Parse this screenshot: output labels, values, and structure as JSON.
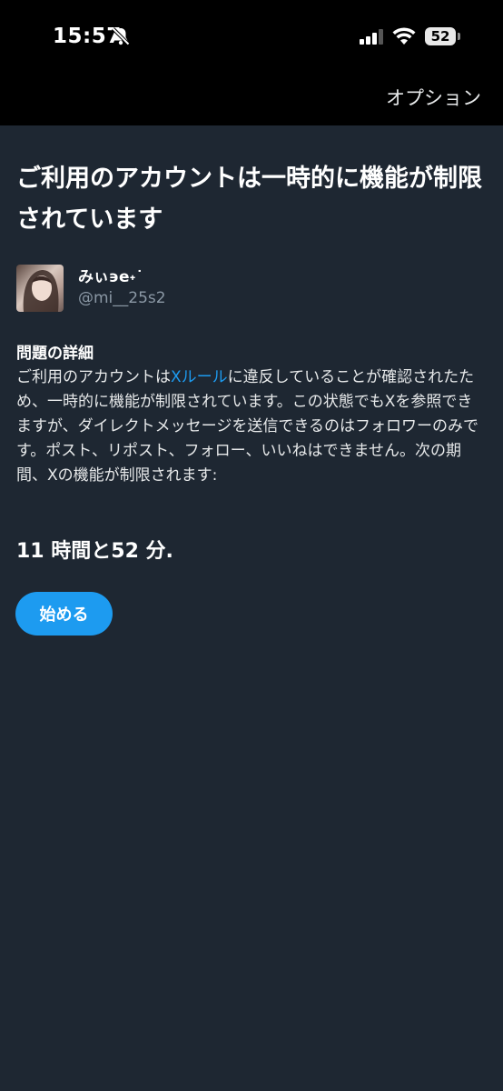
{
  "status_bar": {
    "time": "15:57",
    "battery": "52",
    "icons": [
      "bell-slash-icon",
      "signal-icon",
      "wifi-icon",
      "battery-icon"
    ]
  },
  "nav": {
    "options_label": "オプション"
  },
  "title": "ご利用のアカウントは一時的に機能が制限されています",
  "account": {
    "display_name": "みぃ϶e˖˙",
    "handle": "@mi__25s2"
  },
  "details": {
    "heading": "問題の詳細",
    "text_before_link": "ご利用のアカウントは",
    "link_text": "Xルール",
    "text_after_link": "に違反していることが確認されたため、一時的に機能が制限されています。この状態でもXを参照できますが、ダイレクトメッセージを送信できるのはフォロワーのみです。ポスト、リポスト、フォロー、いいねはできません。次の期間、Xの機能が制限されます:"
  },
  "time_remaining": "11 時間と52 分.",
  "start_button_label": "始める",
  "colors": {
    "background": "#1e2732",
    "top_bar": "#000000",
    "accent": "#1d9bf0",
    "secondary_text": "#8b98a5"
  }
}
